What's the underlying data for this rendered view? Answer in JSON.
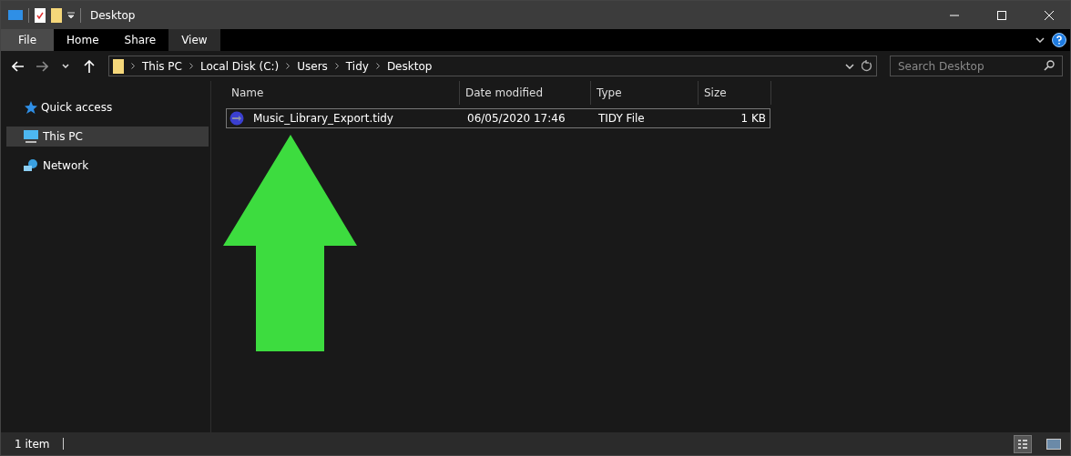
{
  "window": {
    "title": "Desktop"
  },
  "ribbon_tabs": [
    {
      "label": "File",
      "kind": "file",
      "selected": false
    },
    {
      "label": "Home",
      "kind": "tab",
      "selected": false
    },
    {
      "label": "Share",
      "kind": "tab",
      "selected": false
    },
    {
      "label": "View",
      "kind": "tab",
      "selected": true
    }
  ],
  "address": {
    "path": [
      "This PC",
      "Local Disk (C:)",
      "Users",
      "Tidy",
      "Desktop"
    ]
  },
  "search": {
    "placeholder": "Search Desktop"
  },
  "sidebar": {
    "items": [
      {
        "label": "Quick access",
        "kind": "star",
        "selected": false
      },
      {
        "label": "This PC",
        "kind": "pc",
        "selected": true
      },
      {
        "label": "Network",
        "kind": "network",
        "selected": false
      }
    ]
  },
  "table": {
    "columns": [
      "Name",
      "Date modified",
      "Type",
      "Size"
    ],
    "rows": [
      {
        "name": "Music_Library_Export.tidy",
        "date": "06/05/2020 17:46",
        "type": "TIDY File",
        "size": "1 KB",
        "selected": true
      }
    ]
  },
  "status_bar": {
    "count": "1 item"
  }
}
